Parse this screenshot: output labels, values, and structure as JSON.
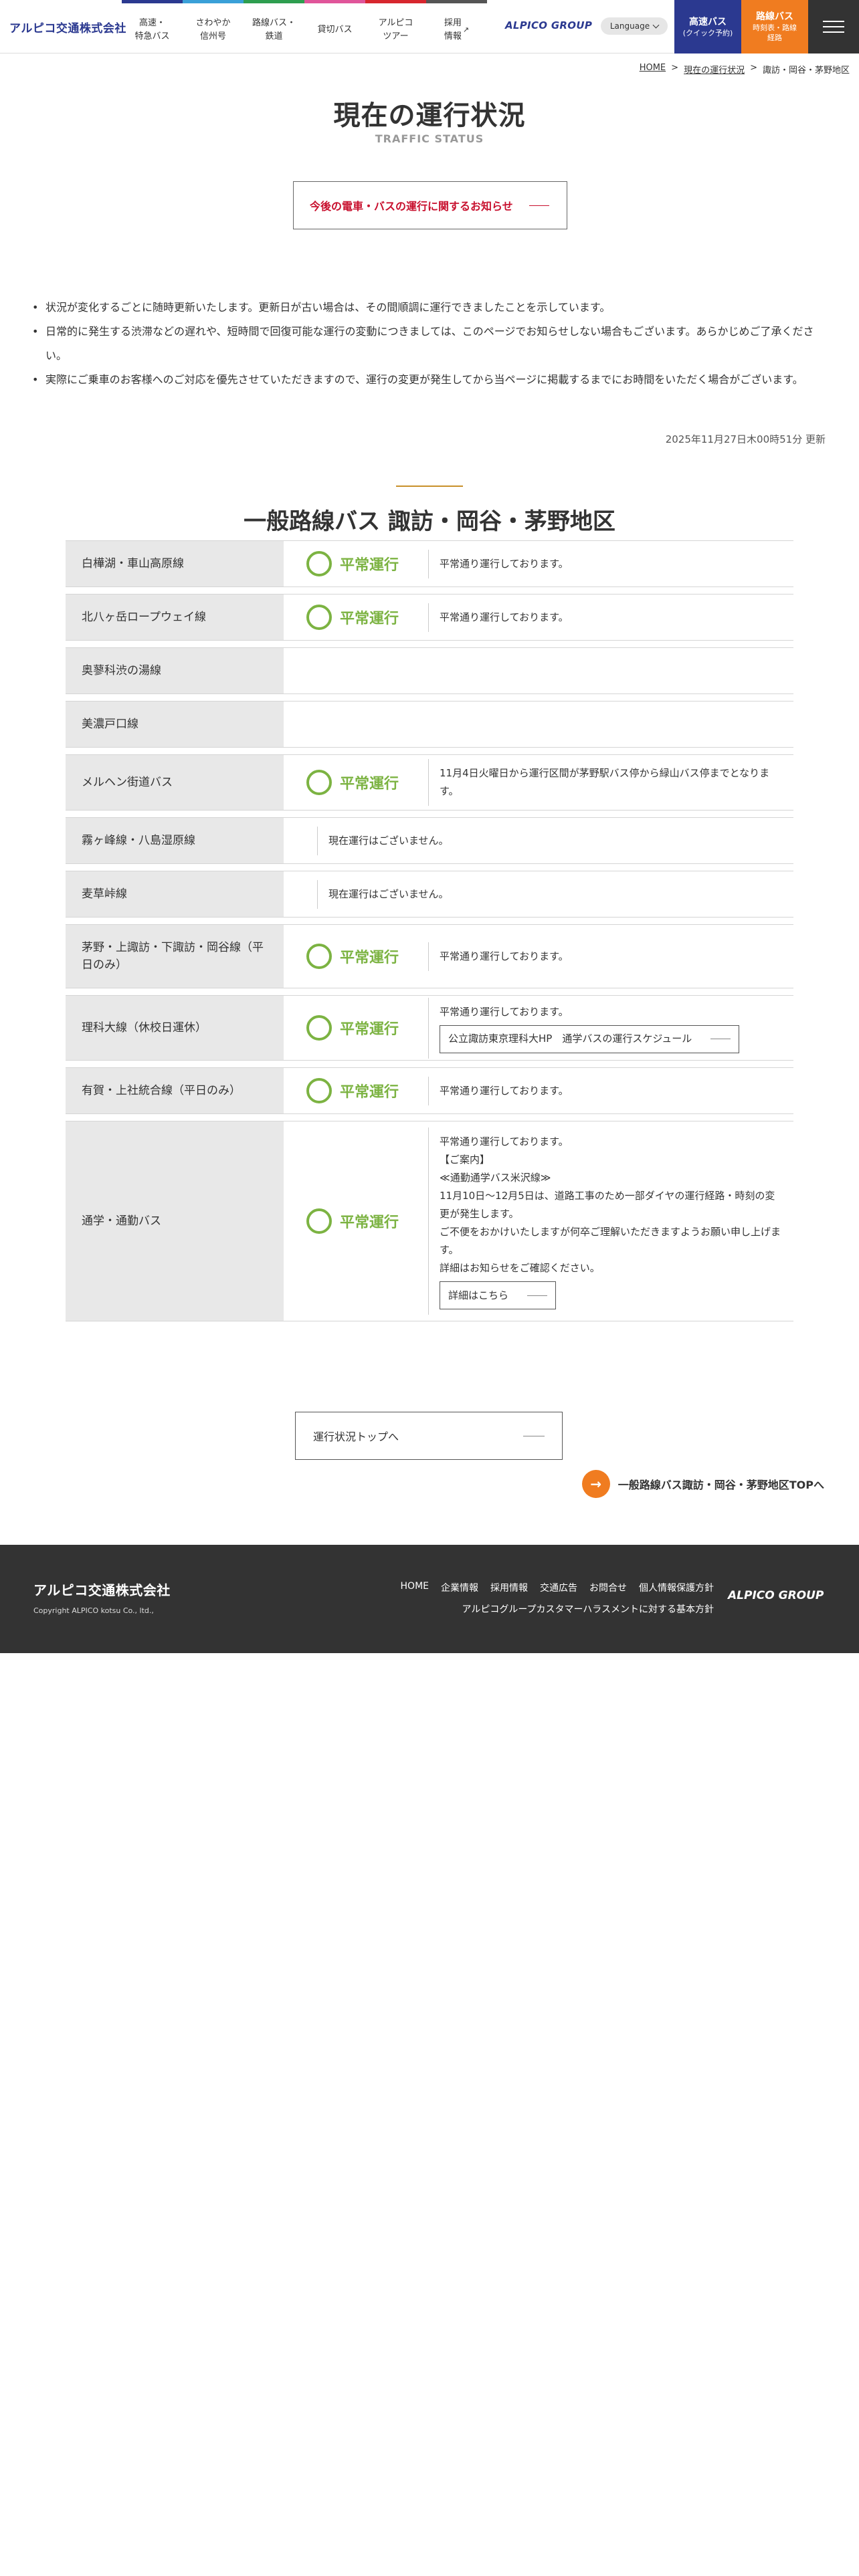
{
  "header": {
    "logo": "アルピコ交通株式会社",
    "nav": [
      {
        "label": "高速・\n特急バス",
        "color": "#2b3990"
      },
      {
        "label": "さわやか\n信州号",
        "color": "#3aa0d8"
      },
      {
        "label": "路線バス・\n鉄道",
        "color": "#2e9e4f"
      },
      {
        "label": "貸切バス",
        "color": "#e0559a"
      },
      {
        "label": "アルピコ\nツアー",
        "color": "#d7262e"
      },
      {
        "label": "採用\n情報",
        "color": "#555555",
        "ext": "↗"
      }
    ],
    "group_logo": "ALPICO GROUP",
    "language": "Language",
    "quick1": {
      "title": "高速バス",
      "sub": "(クイック予約)"
    },
    "quick2": {
      "title": "路線バス",
      "sub": "時刻表・路線\n経路"
    }
  },
  "breadcrumb": {
    "home": "HOME",
    "sep": ">",
    "status": "現在の運行状況",
    "current": "諏訪・岡谷・茅野地区"
  },
  "page": {
    "title": "現在の運行状況",
    "subtitle": "TRAFFIC STATUS",
    "notice_button": "今後の電車・バスの運行に関するお知らせ",
    "notes": [
      "状況が変化するごとに随時更新いたします。更新日が古い場合は、その間順調に運行できましたことを示しています。",
      "日常的に発生する渋滞などの遅れや、短時間で回復可能な運行の変動につきましては、このページでお知らせしない場合もございます。あらかじめご了承ください。",
      "実際にご乗車のお客様へのご対応を優先させていただきますので、運行の変更が発生してから当ページに掲載するまでにお時間をいただく場合がございます。"
    ],
    "updated": "2025年11月27日木00時51分 更新"
  },
  "section": {
    "title": "一般路線バス 諏訪・岡谷・茅野地区",
    "status_normal": "平常運行",
    "rows": [
      {
        "name": "白樺湖・車山高原線",
        "status": "平常運行",
        "message": "平常通り運行しております。"
      },
      {
        "name": "北八ヶ岳ロープウェイ線",
        "status": "平常運行",
        "message": "平常通り運行しております。"
      },
      {
        "name": "奥蓼科渋の湯線",
        "status": "",
        "message": ""
      },
      {
        "name": "美濃戸口線",
        "status": "",
        "message": ""
      },
      {
        "name": "メルヘン街道バス",
        "status": "平常運行",
        "message": "11月4日火曜日から運行区間が茅野駅バス停から緑山バス停までとなります。"
      },
      {
        "name": "霧ヶ峰線・八島湿原線",
        "status": "none",
        "message": "現在運行はございません。"
      },
      {
        "name": "麦草峠線",
        "status": "none",
        "message": "現在運行はございません。"
      },
      {
        "name": "茅野・上諏訪・下諏訪・岡谷線（平日のみ）",
        "status": "平常運行",
        "message": "平常通り運行しております。"
      },
      {
        "name": "理科大線（休校日運休）",
        "status": "平常運行",
        "message": "平常通り運行しております。",
        "link": "公立諏訪東京理科大HP　通学バスの運行スケジュール"
      },
      {
        "name": "有賀・上社統合線（平日のみ）",
        "status": "平常運行",
        "message": "平常通り運行しております。"
      },
      {
        "name": "通学・通勤バス",
        "status": "平常運行",
        "message": "平常通り運行しております。\n【ご案内】\n≪通勤通学バス米沢線≫\n11月10日～12月5日は、道路工事のため一部ダイヤの運行経路・時刻の変更が発生します。\nご不便をおかけいたしますが何卒ご理解いただきますようお願い申し上げます。\n詳細はお知らせをご確認ください。",
        "link": "詳細はこちら"
      }
    ]
  },
  "bottom": {
    "top_button": "運行状況トップへ",
    "area_top": "一般路線バス諏訪・岡谷・茅野地区TOPへ",
    "arrow": "→"
  },
  "footer": {
    "logo": "アルピコ交通株式会社",
    "copyright": "Copyright ALPICO kotsu Co., ltd.,",
    "links": [
      "HOME",
      "企業情報",
      "採用情報",
      "交通広告",
      "お問合せ",
      "個人情報保護方針"
    ],
    "link2": "アルピコグループカスタマーハラスメントに対する基本方針",
    "group_logo": "ALPICO GROUP"
  }
}
